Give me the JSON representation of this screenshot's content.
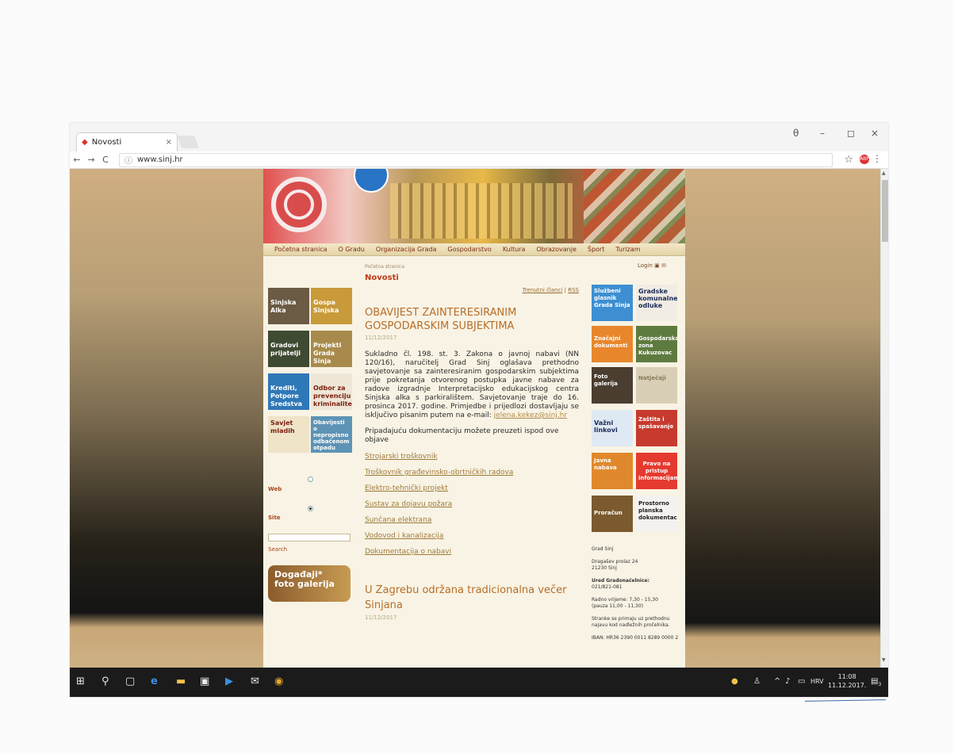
{
  "browser": {
    "tab_title": "Novosti",
    "tab_close": "×",
    "url": "www.sinj.hr",
    "back": "←",
    "forward": "→",
    "reload": "C",
    "star": "☆",
    "menu": "⋮",
    "ext_label": "ABP"
  },
  "window_controls": {
    "profile": "θ",
    "minimize": "–",
    "maximize": "◻",
    "close": "×"
  },
  "site": {
    "menu": [
      "Početna stranica",
      "O Gradu",
      "Organizacija Grada",
      "Gospodarstvo",
      "Kultura",
      "Obrazovanje",
      "Šport",
      "Turizam"
    ],
    "breadcrumb": "Početna stranica",
    "tools_label": "Login",
    "left_tiles": [
      {
        "label": "Sinjska Alka",
        "color": "#6b5a44"
      },
      {
        "label": "Gospa Sinjska",
        "color": "#c89a3a"
      },
      {
        "label": "Gradovi prijatelji",
        "color": "#3f4a32"
      },
      {
        "label": "Projekti Grada Sinja",
        "color": "#a88b4c"
      },
      {
        "label": "Krediti, Potpore Sredstva",
        "color": "#2f78b8"
      },
      {
        "label": "Odbor za prevenciju kriminaliteta",
        "color": "#eee6d6"
      },
      {
        "label": "Savjet mladih",
        "color": "#efe3c8"
      },
      {
        "label": "Obavijesti o nepropisno odbačenom otpadu",
        "color": "#5d93b5"
      }
    ],
    "search": {
      "web_label": "Web",
      "site_label": "Site",
      "button": "Search"
    },
    "gallery_label": "Događaji* foto galerija",
    "section_title": "Novosti",
    "feed_links": {
      "current": "Trenutni članci",
      "sep": "|",
      "rss": "RSS"
    },
    "article1": {
      "title": "OBAVIJEST ZAINTERESIRANIM GOSPODARSKIM SUBJEKTIMA",
      "date": "11/12/2017",
      "body": "Sukladno čl. 198. st. 3. Zakona o javnoj nabavi (NN 120/16), naručitelj Grad Sinj oglašava prethodno savjetovanje sa zainteresiranim gospodarskim subjektima prije pokretanja otvorenog postupka javne nabave za radove izgradnje Interpretacijsko edukacijskog centra Sinjska alka s parkiralištem. Savjetovanje traje do 16. prosinca 2017. godine. Primjedbe i prijedlozi dostavljaju se isključivo pisanim putem na e-mail: ",
      "email": "jelena.kekez@sinj.hr",
      "more": "Pripadajuću dokumentaciju možete preuzeti ispod ove objave",
      "links": [
        "Strojarski troškovnik",
        "Troškovnik građevinsko-obrtničkih radova",
        "Elektro-tehnički projekt",
        "Sustav za dojavu požara",
        "Sunčana elektrana",
        "Vodovod i kanalizacija",
        "Dokumentacija o nabavi"
      ]
    },
    "article2": {
      "title": "U Zagrebu održana tradicionalna večer Sinjana",
      "date": "11/12/2017"
    },
    "right_tiles": [
      {
        "label": "Službeni glasnik Grada Sinja",
        "color": "#3d8fd1"
      },
      {
        "label": "Gradske komunalne odluke",
        "color": "#f1ede4"
      },
      {
        "label": "Značajni dokumenti",
        "color": "#e8862c"
      },
      {
        "label": "Gospodarska zona Kukuzovac",
        "color": "#5e7b3f"
      },
      {
        "label": "Foto galerija",
        "color": "#4b3d30"
      },
      {
        "label": "Natječaji",
        "color": "#d8cfb6"
      },
      {
        "label": "Važni linkovi",
        "color": "#dfe9f3"
      },
      {
        "label": "Zaštita i spašavanje",
        "color": "#c73a2e"
      },
      {
        "label": "Javna nabava",
        "color": "#e0892c"
      },
      {
        "label": "Pravo na pristup informacijama",
        "color": "#e53a30"
      },
      {
        "label": "Proračun",
        "color": "#7a5a2e"
      },
      {
        "label": "Prostorno planska dokumentacija",
        "color": "#f4f2ee"
      }
    ],
    "contact": {
      "name": "Grad Sinj",
      "address": "Dragašev prolaz 24",
      "zip": "21230 Sinj",
      "office_title": "Ured Gradonačelnice:",
      "phone": "021/821-081",
      "hours": "Radno vrijeme: 7,30 - 15,30",
      "pause": "(pauza 11,00 - 11,30)",
      "note": "Stranke se primaju uz prethodnu najavu kod nadležnih pročelnika.",
      "iban": "IBAN: HR36 2390 0011 8289 0000 2"
    }
  },
  "taskbar": {
    "tray_lang": "HRV",
    "time": "11:08",
    "date": "11.12.2017.",
    "notif_count": "3"
  }
}
